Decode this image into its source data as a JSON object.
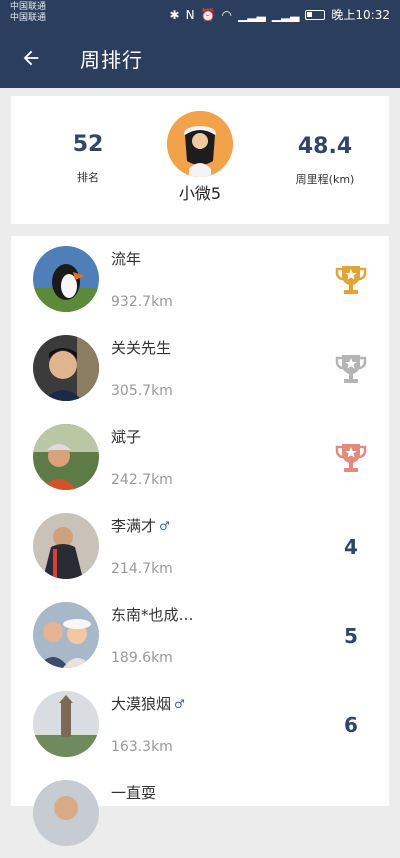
{
  "status_bar": {
    "carrier_1": "中国联通",
    "carrier_2": "中国联通",
    "time": "晚上10:32"
  },
  "app_bar": {
    "title": "周排行"
  },
  "summary": {
    "rank_value": "52",
    "rank_label": "排名",
    "user_name": "小微5",
    "distance_value": "48.4",
    "distance_label": "周里程(km)"
  },
  "leaderboard": [
    {
      "name": "流年",
      "distance": "932.7km",
      "rank": "1",
      "trophy": "gold-trophy-icon",
      "trophy_color": "#e3a23a"
    },
    {
      "name": "关关先生",
      "distance": "305.7km",
      "rank": "2",
      "trophy": "silver-trophy-icon",
      "trophy_color": "#b5b5b5"
    },
    {
      "name": "斌子",
      "distance": "242.7km",
      "rank": "3",
      "trophy": "bronze-trophy-icon",
      "trophy_color": "#e08b7c"
    },
    {
      "name": "李满才",
      "distance": "214.7km",
      "rank": "4",
      "gender": "♂"
    },
    {
      "name": "东南*也成…",
      "distance": "189.6km",
      "rank": "5"
    },
    {
      "name": "大漠狼烟",
      "distance": "163.3km",
      "rank": "6",
      "gender": "♂"
    },
    {
      "name": "一直耍",
      "distance": "",
      "rank": ""
    }
  ],
  "colors": {
    "primary": "#2c3e5e",
    "accent": "#2f4667"
  }
}
